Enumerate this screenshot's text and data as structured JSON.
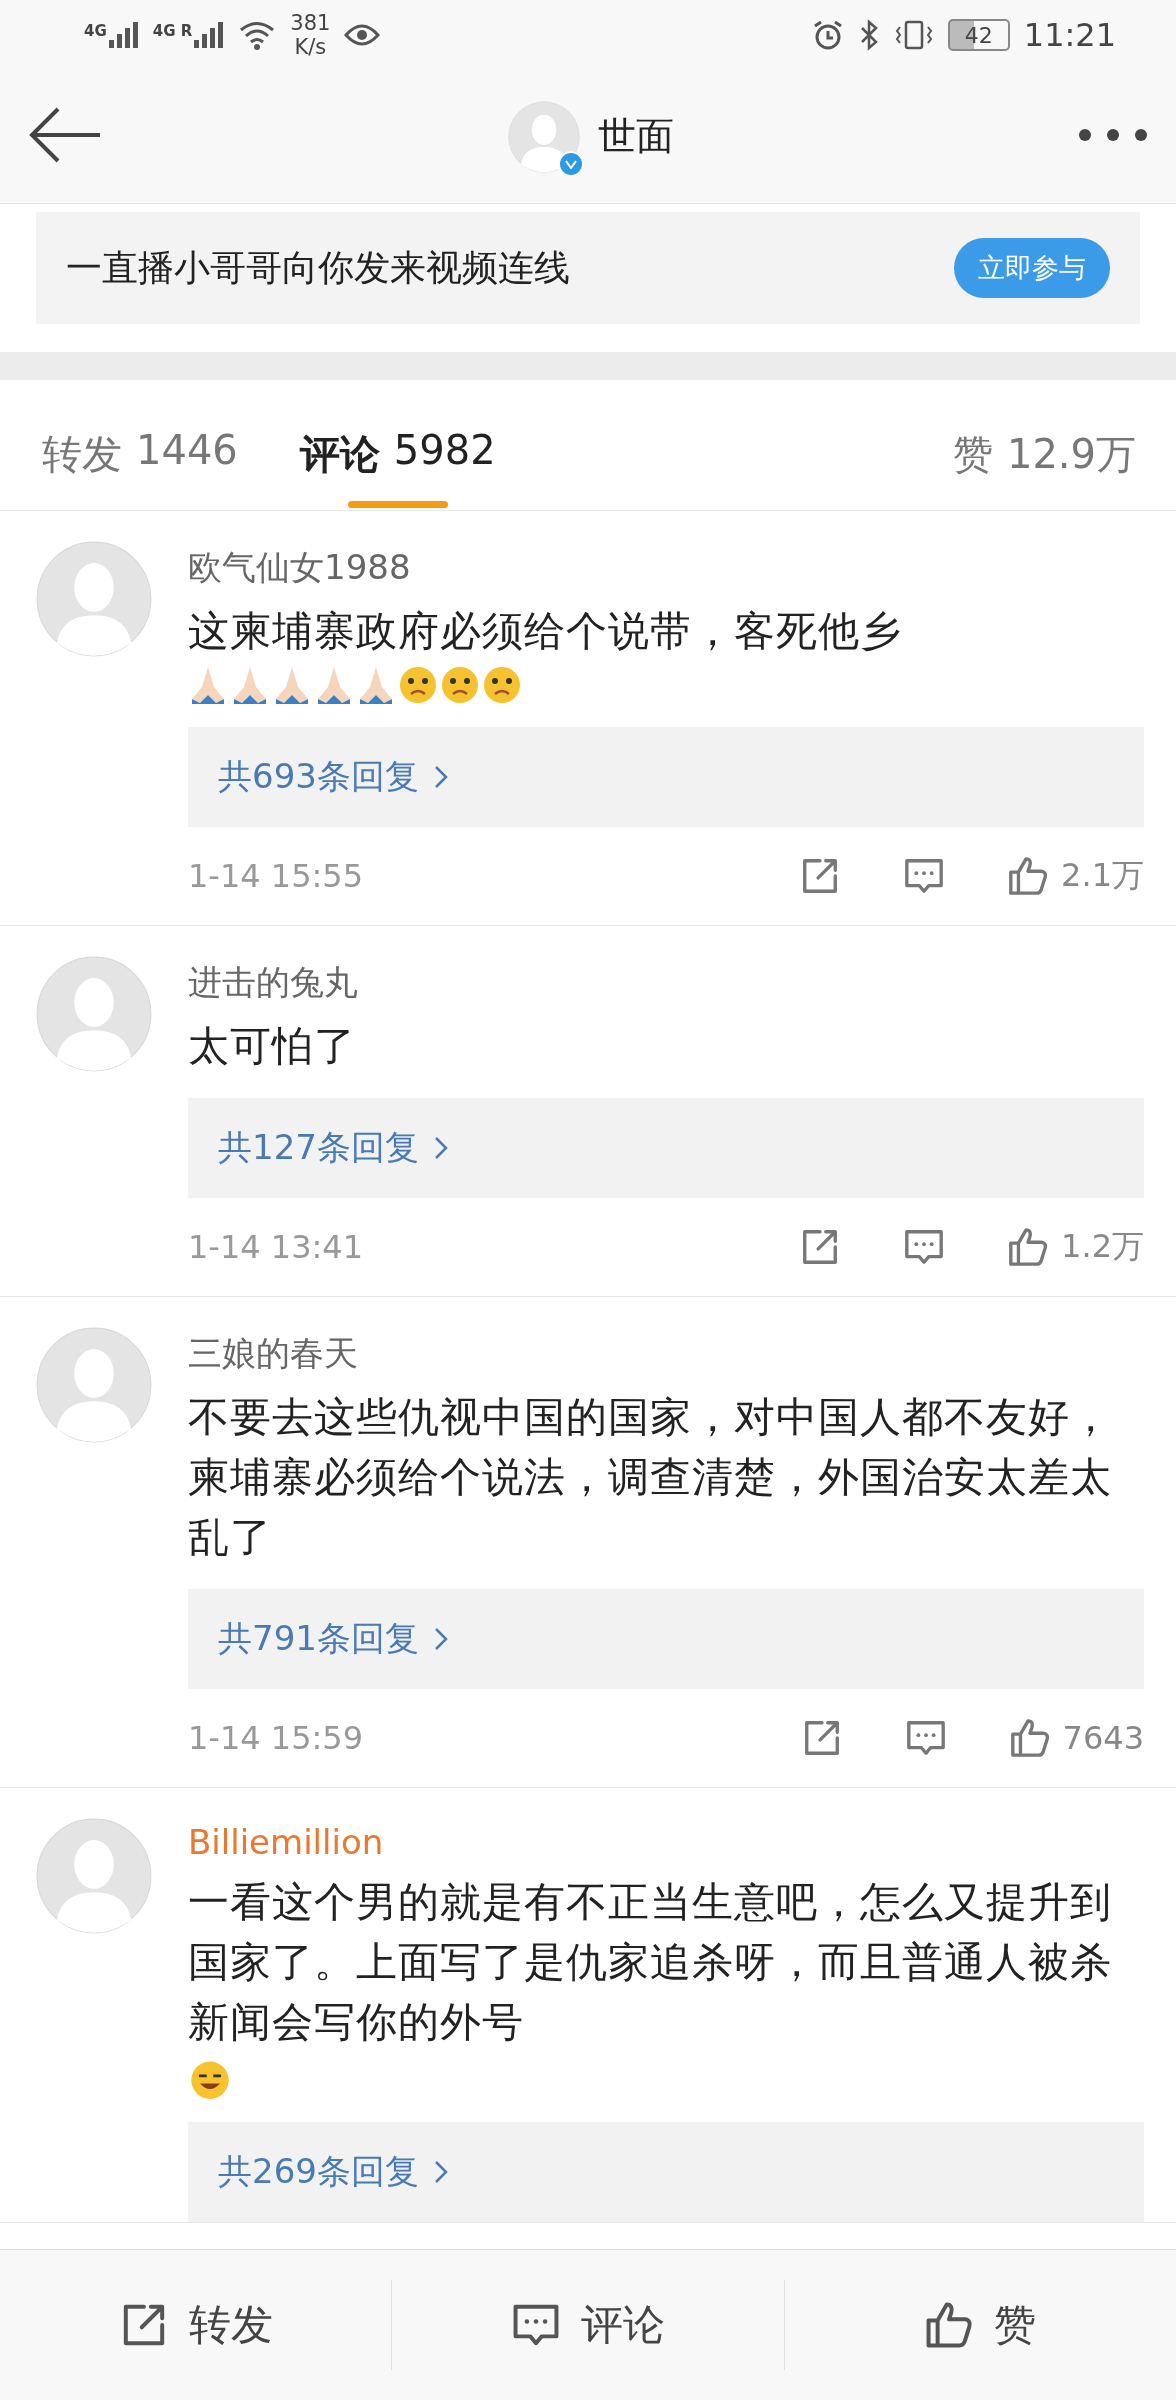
{
  "status_bar": {
    "networks": [
      "4G",
      "4G R"
    ],
    "speed": "381",
    "speed_unit": "K/s",
    "battery": "42",
    "time": "11:21"
  },
  "header": {
    "title": "世面",
    "verified": true
  },
  "banner": {
    "text": "一直播小哥哥向你发来视频连线",
    "button": "立即参与"
  },
  "tabs": [
    {
      "label": "转发",
      "count": "1446",
      "selected": false
    },
    {
      "label": "评论",
      "count": "5982",
      "selected": true
    },
    {
      "label": "赞",
      "count": "12.9万",
      "selected": false
    }
  ],
  "comments": [
    {
      "name": "欧气仙女1988",
      "vip": false,
      "text": "这柬埔寨政府必须给个说带，客死他乡",
      "emojis": [
        {
          "kind": "pray"
        },
        {
          "kind": "pray"
        },
        {
          "kind": "pray"
        },
        {
          "kind": "pray"
        },
        {
          "kind": "pray"
        },
        {
          "kind": "sad"
        },
        {
          "kind": "sad"
        },
        {
          "kind": "sad"
        }
      ],
      "replies": "共693条回复",
      "time": "1-14 15:55",
      "likes": "2.1万"
    },
    {
      "name": "进击的兔丸",
      "vip": false,
      "text": "太可怕了",
      "replies": "共127条回复",
      "time": "1-14 13:41",
      "likes": "1.2万"
    },
    {
      "name": "三娘的春天",
      "vip": false,
      "text": "不要去这些仇视中国的国家，对中国人都不友好，柬埔寨必须给个说法，调查清楚，外国治安太差太乱了",
      "replies": "共791条回复",
      "time": "1-14 15:59",
      "likes": "7643"
    },
    {
      "name": "Billiemillion",
      "vip": true,
      "text": "一看这个男的就是有不正当生意吧，怎么又提升到国家了。上面写了是仇家追杀呀，而且普通人被杀新闻会写你的外号",
      "emojis": [
        {
          "kind": "dizzy"
        }
      ],
      "replies": "共269条回复"
    }
  ],
  "bottom_bar": [
    {
      "kind": "share",
      "label": "转发"
    },
    {
      "kind": "comment",
      "label": "评论"
    },
    {
      "kind": "like",
      "label": "赞"
    }
  ]
}
